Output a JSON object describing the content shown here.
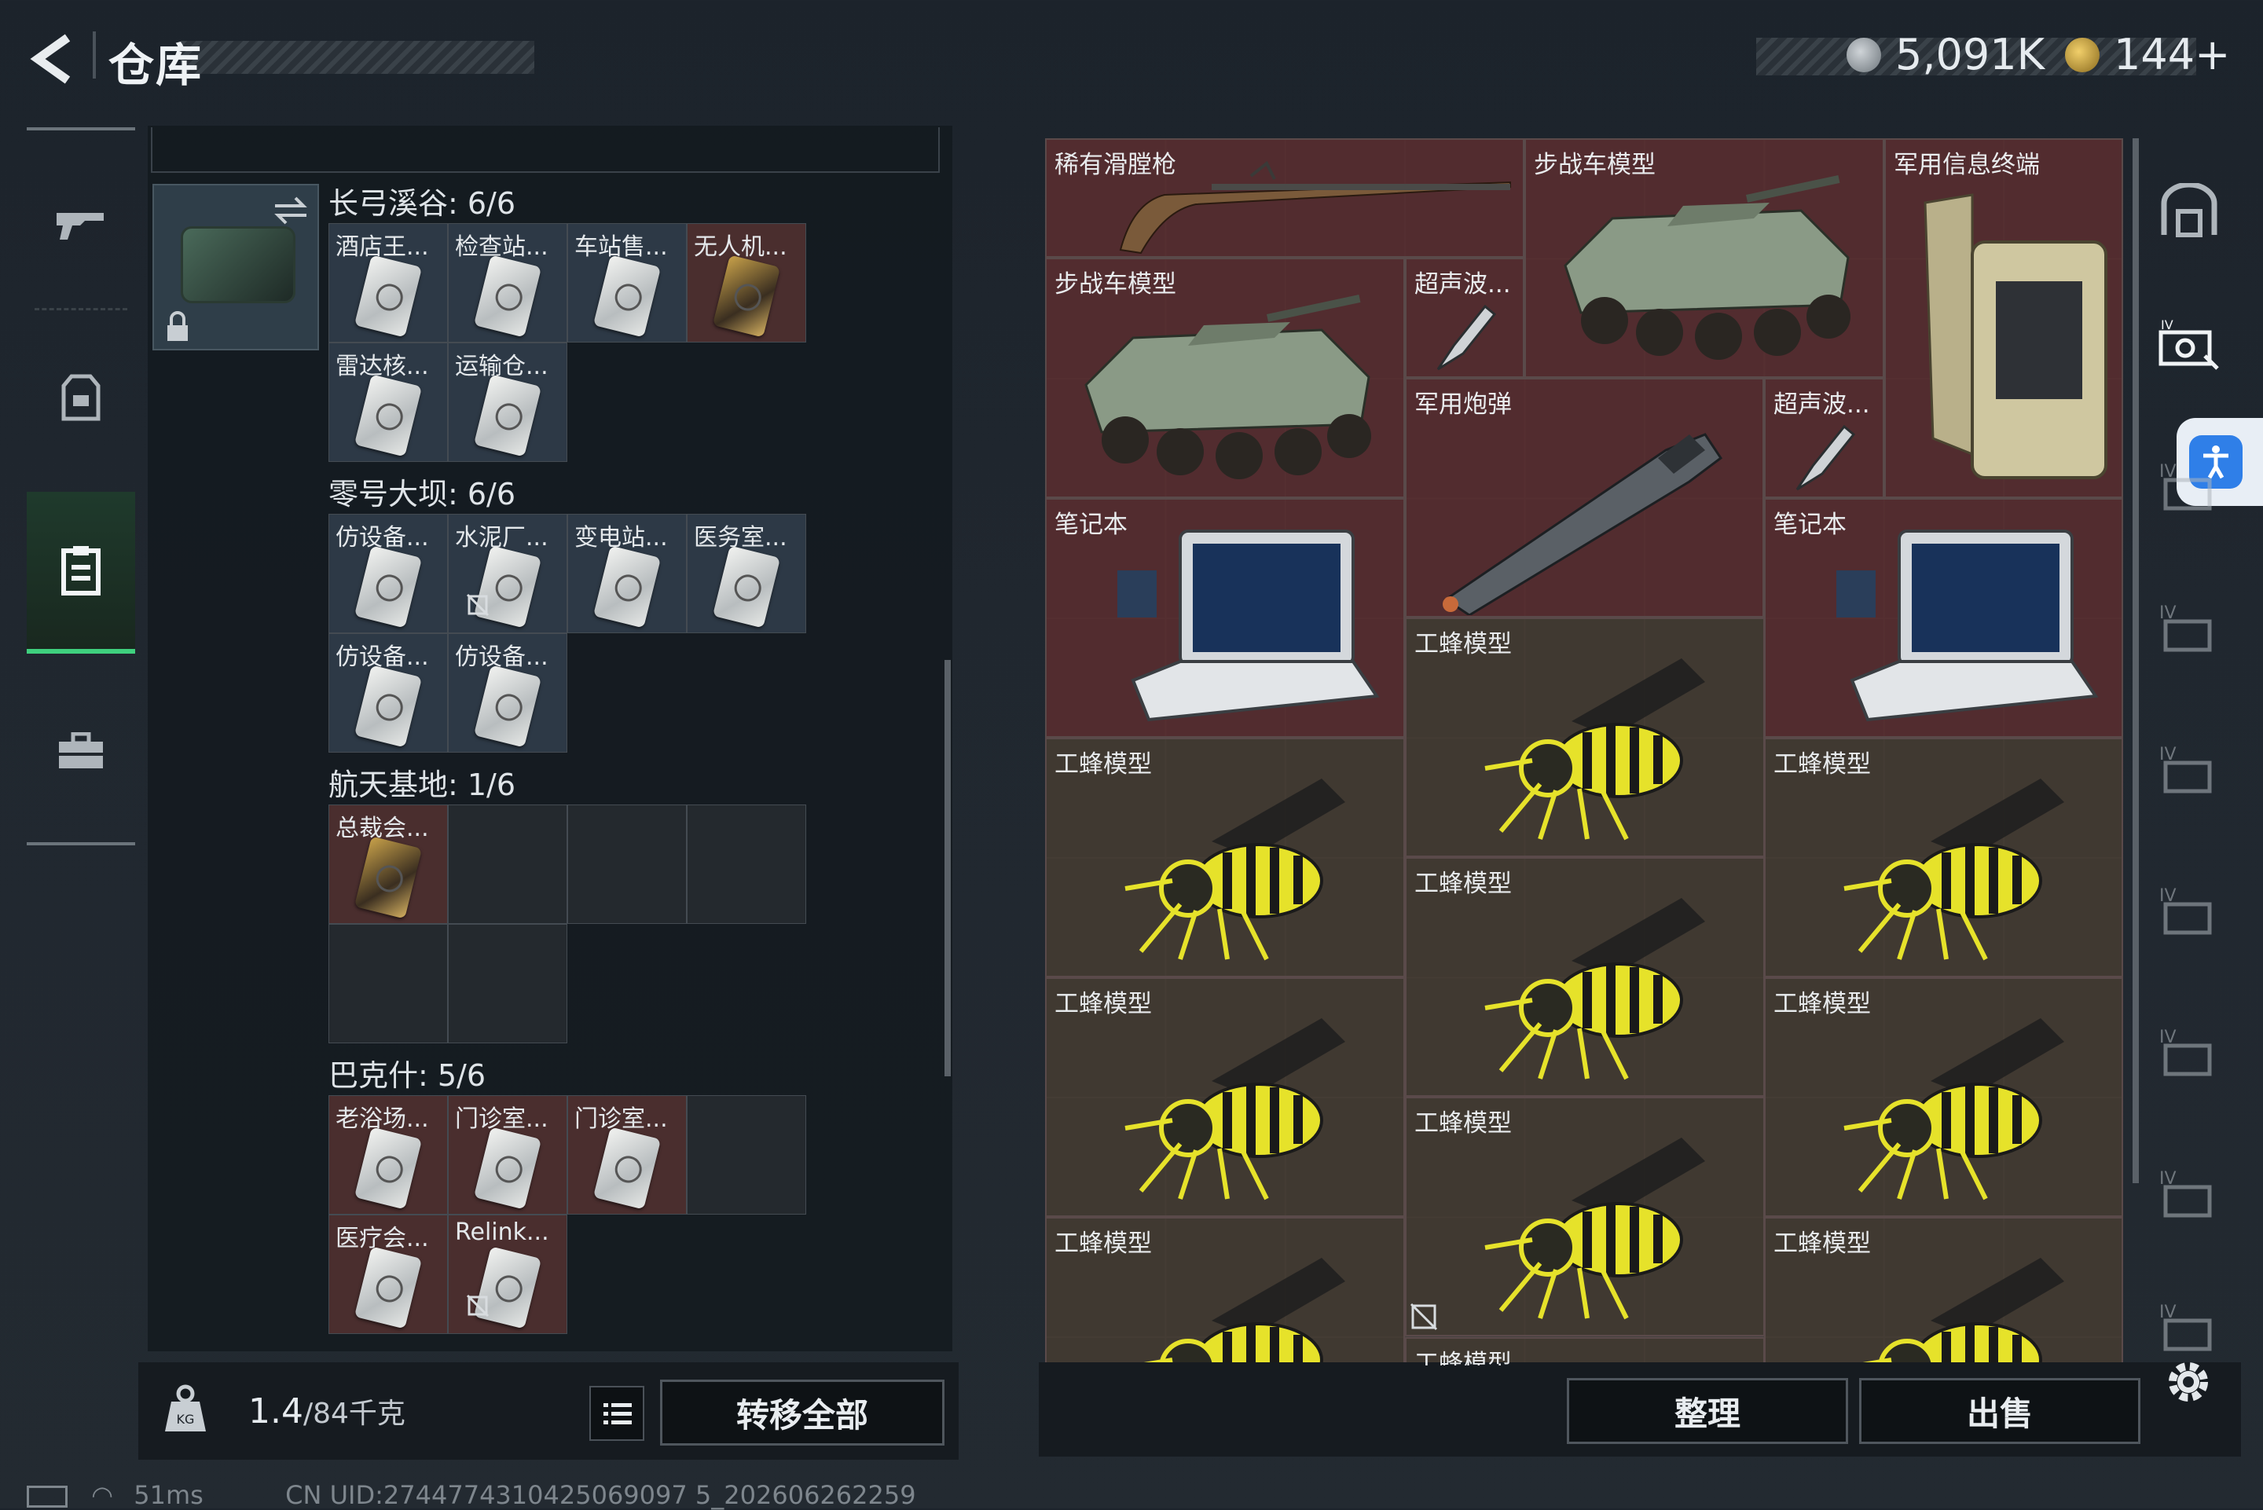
{
  "header": {
    "title": "仓库",
    "currency1": "5,091K",
    "currency2": "144+"
  },
  "left_groups": [
    {
      "title": "长弓溪谷: 6/6",
      "cells": [
        {
          "label": "酒店王...",
          "tone": "blue",
          "item": "card"
        },
        {
          "label": "检查站...",
          "tone": "blue",
          "item": "card"
        },
        {
          "label": "车站售...",
          "tone": "blue",
          "item": "card"
        },
        {
          "label": "无人机...",
          "tone": "red",
          "item": "card-gold"
        },
        {
          "label": "雷达核...",
          "tone": "blue",
          "item": "card"
        },
        {
          "label": "运输仓...",
          "tone": "blue",
          "item": "card"
        }
      ]
    },
    {
      "title": "零号大坝: 6/6",
      "cells": [
        {
          "label": "仿设备...",
          "tone": "blue",
          "item": "card"
        },
        {
          "label": "水泥厂...",
          "tone": "blue",
          "item": "card",
          "no_transfer": true
        },
        {
          "label": "变电站...",
          "tone": "blue",
          "item": "card"
        },
        {
          "label": "医务室...",
          "tone": "blue",
          "item": "card"
        },
        {
          "label": "仿设备...",
          "tone": "blue",
          "item": "card"
        },
        {
          "label": "仿设备...",
          "tone": "blue",
          "item": "card"
        }
      ]
    },
    {
      "title": "航天基地: 1/6",
      "cells": [
        {
          "label": "总裁会...",
          "tone": "red",
          "item": "card-gold"
        },
        {
          "label": "",
          "tone": "empty"
        },
        {
          "label": "",
          "tone": "empty"
        },
        {
          "label": "",
          "tone": "empty"
        },
        {
          "label": "",
          "tone": "empty"
        },
        {
          "label": "",
          "tone": "empty"
        }
      ]
    },
    {
      "title": "巴克什: 5/6",
      "cells": [
        {
          "label": "老浴场...",
          "tone": "red",
          "item": "card"
        },
        {
          "label": "门诊室...",
          "tone": "red",
          "item": "card"
        },
        {
          "label": "门诊室...",
          "tone": "red",
          "item": "card"
        },
        {
          "label": "",
          "tone": "empty"
        },
        {
          "label": "医疗会...",
          "tone": "red",
          "item": "card"
        },
        {
          "label": "Relink...",
          "tone": "red",
          "item": "card",
          "no_transfer": true
        }
      ]
    }
  ],
  "right_items": {
    "musket": "稀有滑膛枪",
    "ifv1": "步战车模型",
    "terminal": "军用信息终端",
    "ifv2": "步战车模型",
    "ultra1": "超声波...",
    "shell": "军用炮弹",
    "ultra2": "超声波...",
    "laptop1": "笔记本",
    "laptop2": "笔记本",
    "bee_c1": "工蜂模型",
    "bee_l1": "工蜂模型",
    "bee_r1": "工蜂模型",
    "bee_c2": "工蜂模型",
    "bee_l2": "工蜂模型",
    "bee_r2": "工蜂模型",
    "bee_c3": "工蜂模型",
    "bee_l3": "工蜂模型",
    "bee_r3": "工蜂模型",
    "bee_c4": "工蜂模型"
  },
  "right_side_tabs": [
    "IV",
    "IV",
    "IV",
    "IV",
    "IV",
    "IV",
    "IV"
  ],
  "bottom": {
    "weight_current": "1.4",
    "weight_max": "/84千克",
    "weight_unit": "KG",
    "transfer_all": "转移全部",
    "organize": "整理",
    "sell": "出售"
  },
  "status": {
    "ping": "51ms",
    "uid": "CN UID:2744774310425069097 5_202606262259"
  },
  "colors": {
    "accent_green": "#3fd07e",
    "cell_red": "#4a2e2e",
    "cell_blue": "#2d3946",
    "bee_yellow": "#e6e22a"
  }
}
